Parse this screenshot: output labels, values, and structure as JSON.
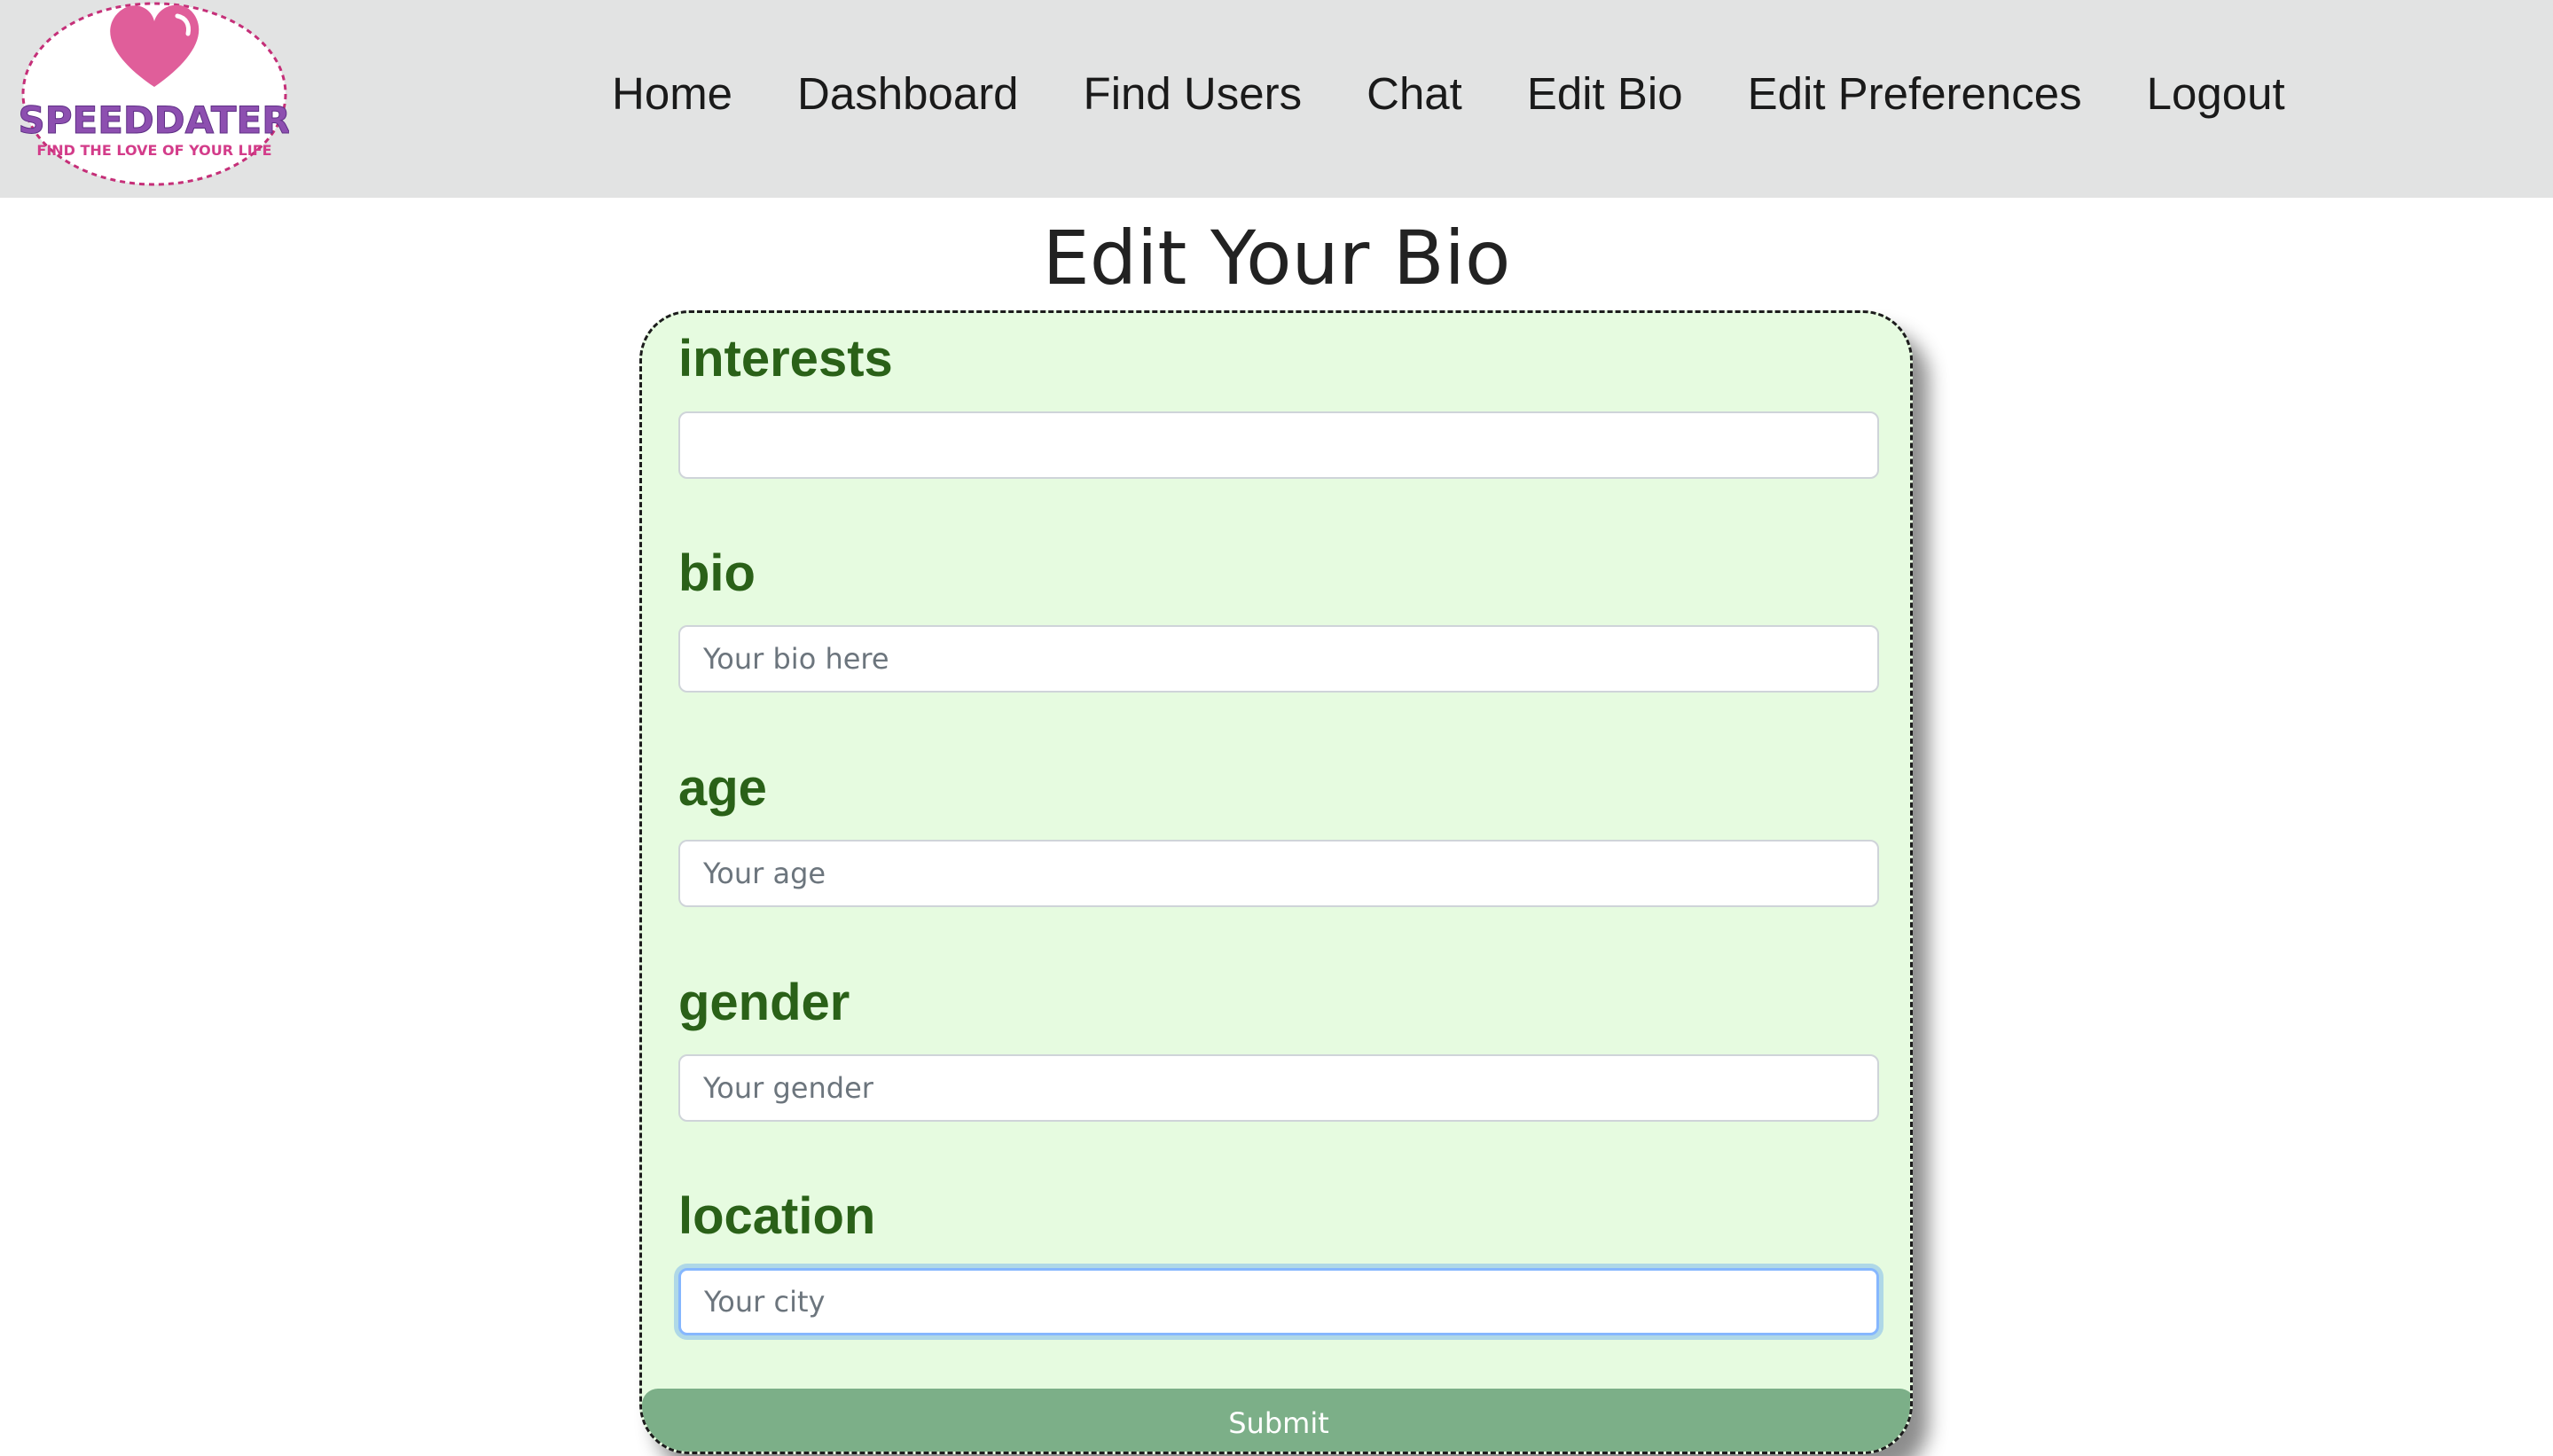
{
  "brand": {
    "name": "SPEEDDATER",
    "tagline": "FIND THE LOVE OF YOUR LIFE",
    "colors": {
      "heart": "#e05e9a",
      "text": "#8d4fb0",
      "tagline": "#d33c8a",
      "border": "#c52f78"
    }
  },
  "nav": {
    "links": [
      {
        "label": "Home"
      },
      {
        "label": "Dashboard"
      },
      {
        "label": "Find Users"
      },
      {
        "label": "Chat"
      },
      {
        "label": "Edit Bio"
      },
      {
        "label": "Edit Preferences"
      },
      {
        "label": "Logout"
      }
    ]
  },
  "page": {
    "title": "Edit Your Bio"
  },
  "form": {
    "fields": [
      {
        "label": "interests",
        "placeholder": "",
        "value": ""
      },
      {
        "label": "bio",
        "placeholder": "Your bio here",
        "value": ""
      },
      {
        "label": "age",
        "placeholder": "Your age",
        "value": ""
      },
      {
        "label": "gender",
        "placeholder": "Your gender",
        "value": ""
      },
      {
        "label": "location",
        "placeholder": "Your city",
        "value": "",
        "focused": true
      }
    ],
    "submit_label": "Submit"
  },
  "colors": {
    "navbar_bg": "#e2e3e3",
    "card_bg": "#e6fbe0",
    "label_green": "#2a6118",
    "submit_bg": "#7caf88"
  }
}
